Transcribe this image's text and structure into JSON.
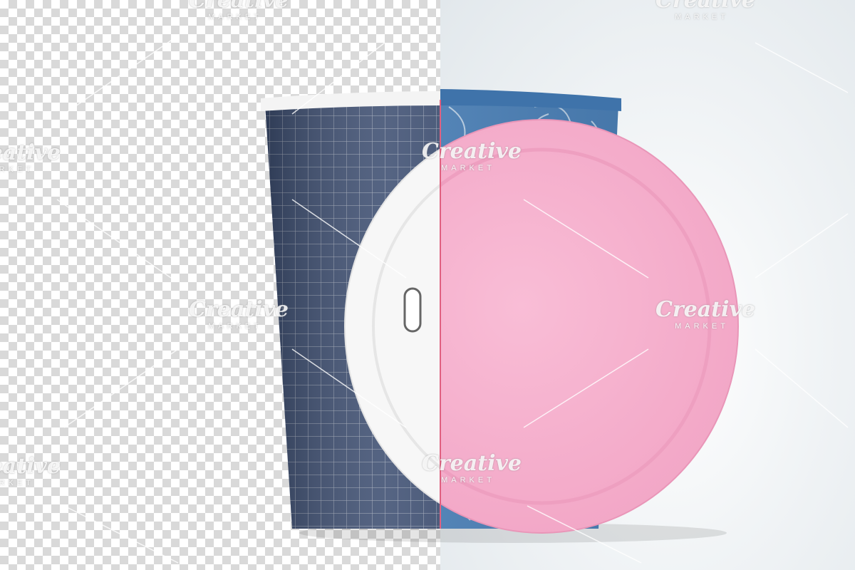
{
  "image": {
    "subject": "paper-cup-with-lid-mockup",
    "colors": {
      "cup_left": "#3e4f72",
      "cup_right": "#4b7fb5",
      "cup_rim": "#f4f4f4",
      "lid_white": "#f7f7f7",
      "lid_pink": "#f6b3cf",
      "divider": "#e06080",
      "checker_dark": "#d9d9d9",
      "checker_light": "#ffffff",
      "background": "#eef2f4"
    }
  },
  "watermark": {
    "word": "Creative",
    "sub": "MARKET"
  }
}
